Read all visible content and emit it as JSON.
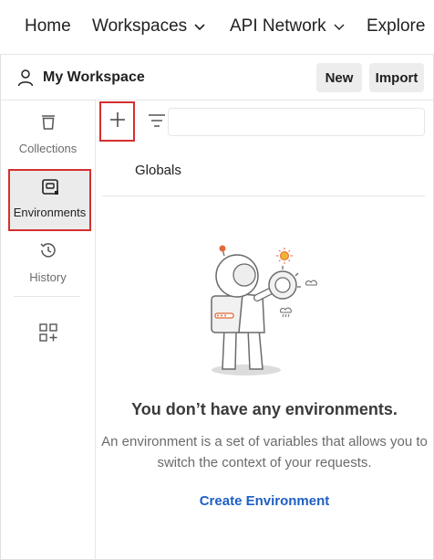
{
  "topnav": {
    "home": "Home",
    "workspaces": "Workspaces",
    "api_network": "API Network",
    "explore": "Explore"
  },
  "workspace": {
    "title": "My Workspace",
    "new_label": "New",
    "import_label": "Import"
  },
  "sidebar": {
    "items": [
      {
        "label": "Collections",
        "icon": "trash-bin-icon"
      },
      {
        "label": "Environments",
        "icon": "environment-icon",
        "active": true
      },
      {
        "label": "History",
        "icon": "history-clock-icon"
      },
      {
        "label": "",
        "icon": "configure-workbench-icon"
      }
    ]
  },
  "environments": {
    "search_value": "",
    "globals_label": "Globals",
    "empty_title": "You don’t have any environments.",
    "empty_desc": "An environment is a set of variables that allows you to switch the context of your requests.",
    "create_label": "Create Environment"
  },
  "colors": {
    "highlight_border": "#d62f2f",
    "link": "#1f5fc4",
    "active_bg": "#ebebeb",
    "button_bg": "#ededed"
  }
}
